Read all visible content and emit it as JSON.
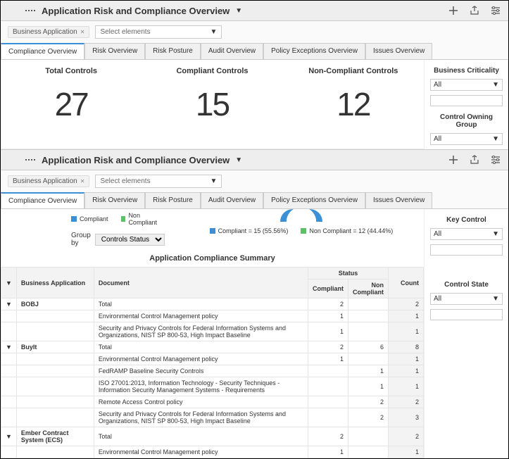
{
  "header": {
    "title": "Application Risk and Compliance Overview"
  },
  "filter": {
    "label": "Business Application",
    "select_placeholder": "Select elements"
  },
  "tabs": [
    {
      "label": "Compliance Overview",
      "active": true
    },
    {
      "label": "Risk Overview",
      "active": false
    },
    {
      "label": "Risk Posture",
      "active": false
    },
    {
      "label": "Audit Overview",
      "active": false
    },
    {
      "label": "Policy Exceptions Overview",
      "active": false
    },
    {
      "label": "Issues Overview",
      "active": false
    }
  ],
  "stats": {
    "total": {
      "label": "Total Controls",
      "value": "27"
    },
    "compliant": {
      "label": "Compliant Controls",
      "value": "15"
    },
    "noncompliant": {
      "label": "Non-Compliant Controls",
      "value": "12"
    }
  },
  "right_filters": {
    "business_criticality": {
      "label": "Business Criticality",
      "value": "All"
    },
    "control_owning_group": {
      "label": "Control Owning Group",
      "value": "All"
    },
    "key_control": {
      "label": "Key Control",
      "value": "All"
    },
    "control_state": {
      "label": "Control State",
      "value": "All"
    }
  },
  "legend_top": {
    "compliant": "Compliant",
    "noncompliant": "Non Compliant"
  },
  "legend_mid": {
    "compliant": "Compliant = 15 (55.56%)",
    "noncompliant": "Non Compliant = 12 (44.44%)"
  },
  "groupby": {
    "label": "Group by",
    "value": "Controls Status"
  },
  "summary": {
    "title": "Application Compliance Summary",
    "cols": {
      "app": "Business Application",
      "doc": "Document",
      "status": "Status",
      "compliant": "Compliant",
      "noncompliant": "Non Compliant",
      "count": "Count"
    },
    "rows": [
      {
        "app": "BOBJ",
        "doc": "Total",
        "compliant": "2",
        "noncompliant": "",
        "count": "2",
        "expand": true
      },
      {
        "app": "",
        "doc": "Environmental Control Management policy",
        "compliant": "1",
        "noncompliant": "",
        "count": "1"
      },
      {
        "app": "",
        "doc": "Security and Privacy Controls for Federal Information Systems and Organizations, NIST SP 800-53, High Impact Baseline",
        "compliant": "1",
        "noncompliant": "",
        "count": "1"
      },
      {
        "app": "BuyIt",
        "doc": "Total",
        "compliant": "2",
        "noncompliant": "6",
        "count": "8",
        "expand": true
      },
      {
        "app": "",
        "doc": "Environmental Control Management policy",
        "compliant": "1",
        "noncompliant": "",
        "count": "1"
      },
      {
        "app": "",
        "doc": "FedRAMP Baseline Security Controls",
        "compliant": "",
        "noncompliant": "1",
        "count": "1"
      },
      {
        "app": "",
        "doc": "ISO 27001:2013, Information Technology - Security Techniques - Information Security Management Systems - Requirements",
        "compliant": "",
        "noncompliant": "1",
        "count": "1"
      },
      {
        "app": "",
        "doc": "Remote Access Control policy",
        "compliant": "",
        "noncompliant": "2",
        "count": "2"
      },
      {
        "app": "",
        "doc": "Security and Privacy Controls for Federal Information Systems and Organizations, NIST SP 800-53, High Impact Baseline",
        "compliant": "",
        "noncompliant": "2",
        "count": "3"
      },
      {
        "app": "Ember Contract System (ECS)",
        "doc": "Total",
        "compliant": "2",
        "noncompliant": "",
        "count": "2",
        "expand": true
      },
      {
        "app": "",
        "doc": "Environmental Control Management policy",
        "compliant": "1",
        "noncompliant": "",
        "count": "1"
      }
    ]
  }
}
